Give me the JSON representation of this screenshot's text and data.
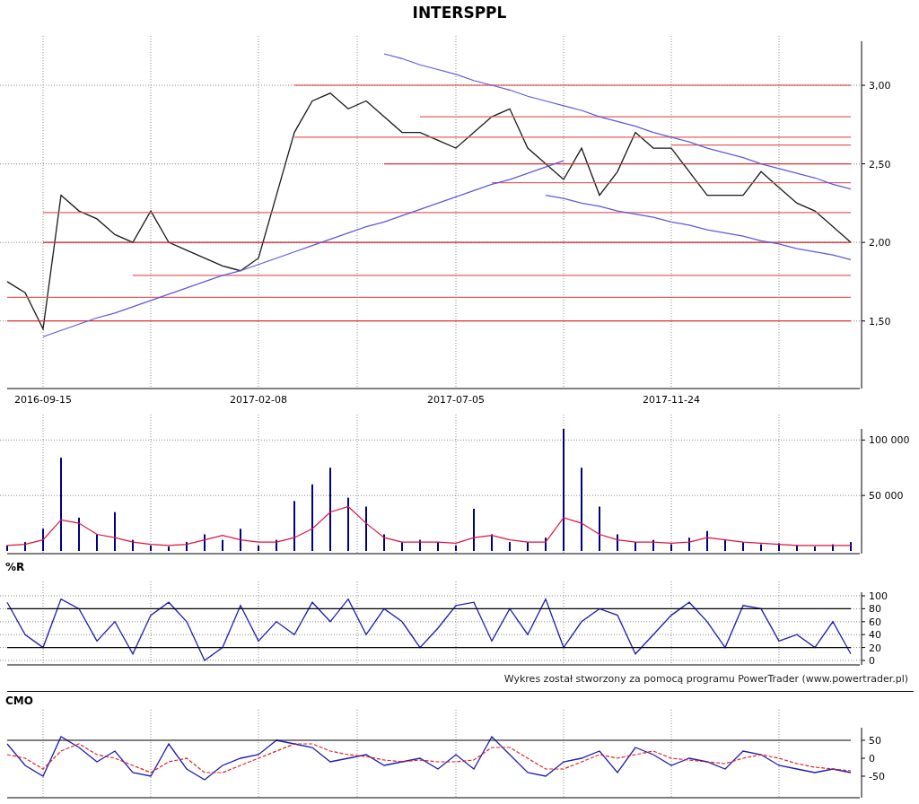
{
  "title": "INTERSPPL",
  "price_panel": {
    "chart_data": {
      "type": "line",
      "categories": [
        null,
        null,
        "2016-09-15",
        null,
        null,
        null,
        null,
        null,
        null,
        null,
        null,
        null,
        null,
        null,
        "2017-02-08",
        null,
        null,
        null,
        null,
        null,
        null,
        null,
        null,
        null,
        null,
        "2017-07-05",
        null,
        null,
        null,
        null,
        null,
        null,
        null,
        null,
        null,
        null,
        null,
        "2017-11-24",
        null,
        null,
        null,
        null,
        null,
        null,
        null,
        null,
        null,
        null
      ],
      "ylim": [
        1.07,
        3.28
      ],
      "grid": true,
      "yticks": [
        {
          "value": 1.5,
          "label": "1,50"
        },
        {
          "value": 2.0,
          "label": "2,00"
        },
        {
          "value": 2.5,
          "label": "2,50"
        },
        {
          "value": 3.0,
          "label": "3,00"
        }
      ],
      "series": [
        {
          "color": "#1a1a1a",
          "values": [
            1.75,
            1.68,
            1.45,
            2.3,
            2.2,
            2.15,
            2.05,
            2.0,
            2.2,
            2.0,
            1.95,
            1.9,
            1.85,
            1.82,
            1.9,
            2.3,
            2.7,
            2.9,
            2.95,
            2.85,
            2.9,
            2.8,
            2.7,
            2.7,
            2.65,
            2.6,
            2.7,
            2.8,
            2.85,
            2.6,
            2.5,
            2.4,
            2.6,
            2.3,
            2.45,
            2.7,
            2.6,
            2.6,
            2.45,
            2.3,
            2.3,
            2.3,
            2.45,
            2.35,
            2.25,
            2.2,
            2.1,
            2.0
          ]
        },
        {
          "color": "#e03030",
          "values": [
            null,
            null,
            null,
            null,
            null,
            null,
            null,
            null,
            null,
            null,
            null,
            null,
            null,
            null,
            null,
            null,
            3.0,
            3.0,
            3.0,
            3.0,
            3.0,
            3.0,
            3.0,
            3.0,
            3.0,
            3.0,
            3.0,
            3.0,
            3.0,
            3.0,
            3.0,
            3.0,
            3.0,
            3.0,
            3.0,
            3.0,
            3.0,
            3.0,
            3.0,
            3.0,
            3.0,
            3.0,
            3.0,
            3.0,
            3.0,
            3.0,
            3.0,
            3.0
          ]
        },
        {
          "color": "#e06060",
          "values": [
            null,
            null,
            null,
            null,
            null,
            null,
            null,
            null,
            null,
            null,
            null,
            null,
            null,
            null,
            null,
            null,
            null,
            null,
            null,
            null,
            null,
            null,
            null,
            2.8,
            2.8,
            2.8,
            2.8,
            2.8,
            2.8,
            2.8,
            2.8,
            2.8,
            2.8,
            2.8,
            2.8,
            2.8,
            2.8,
            2.8,
            2.8,
            2.8,
            2.8,
            2.8,
            2.8,
            2.8,
            2.8,
            2.8,
            2.8,
            2.8
          ]
        },
        {
          "color": "#e06060",
          "values": [
            null,
            null,
            null,
            null,
            null,
            null,
            null,
            null,
            null,
            null,
            null,
            null,
            null,
            null,
            null,
            null,
            2.67,
            2.67,
            2.67,
            2.67,
            2.67,
            2.67,
            2.67,
            2.67,
            2.67,
            2.67,
            2.67,
            2.67,
            2.67,
            2.67,
            2.67,
            2.67,
            2.67,
            2.67,
            2.67,
            2.67,
            2.67,
            2.67,
            2.67,
            2.67,
            2.67,
            2.67,
            2.67,
            2.67,
            2.67,
            2.67,
            2.67,
            2.67
          ]
        },
        {
          "color": "#e06060",
          "values": [
            null,
            null,
            null,
            null,
            null,
            null,
            null,
            null,
            null,
            null,
            null,
            null,
            null,
            null,
            null,
            null,
            null,
            null,
            null,
            null,
            null,
            null,
            null,
            null,
            null,
            null,
            null,
            null,
            null,
            null,
            null,
            null,
            null,
            null,
            null,
            null,
            null,
            2.62,
            2.62,
            2.62,
            2.62,
            2.62,
            2.62,
            2.62,
            2.62,
            2.62,
            2.62,
            2.62
          ]
        },
        {
          "color": "#e03030",
          "values": [
            null,
            null,
            null,
            null,
            null,
            null,
            null,
            null,
            null,
            null,
            null,
            null,
            null,
            null,
            null,
            null,
            null,
            null,
            null,
            null,
            null,
            2.5,
            2.5,
            2.5,
            2.5,
            2.5,
            2.5,
            2.5,
            2.5,
            2.5,
            2.5,
            2.5,
            2.5,
            2.5,
            2.5,
            2.5,
            2.5,
            2.5,
            2.5,
            2.5,
            2.5,
            2.5,
            2.5,
            2.5,
            2.5,
            2.5,
            2.5,
            2.5
          ]
        },
        {
          "color": "#e06060",
          "values": [
            null,
            null,
            null,
            null,
            null,
            null,
            null,
            null,
            null,
            null,
            null,
            null,
            null,
            null,
            null,
            null,
            null,
            null,
            null,
            null,
            null,
            null,
            null,
            null,
            null,
            null,
            null,
            2.38,
            2.38,
            2.38,
            2.38,
            2.38,
            2.38,
            2.38,
            2.38,
            2.38,
            2.38,
            2.38,
            2.38,
            2.38,
            2.38,
            2.38,
            2.38,
            2.38,
            2.38,
            2.38,
            2.38,
            2.38
          ]
        },
        {
          "color": "#e06060",
          "values": [
            null,
            null,
            2.19,
            2.19,
            2.19,
            2.19,
            2.19,
            2.19,
            2.19,
            2.19,
            2.19,
            2.19,
            2.19,
            2.19,
            2.19,
            2.19,
            2.19,
            2.19,
            2.19,
            2.19,
            2.19,
            2.19,
            2.19,
            2.19,
            2.19,
            2.19,
            2.19,
            2.19,
            2.19,
            2.19,
            2.19,
            2.19,
            2.19,
            2.19,
            2.19,
            2.19,
            2.19,
            2.19,
            2.19,
            2.19,
            2.19,
            2.19,
            2.19,
            2.19,
            2.19,
            2.19,
            2.19,
            2.19
          ]
        },
        {
          "color": "#d02020",
          "values": [
            null,
            null,
            2.0,
            2.0,
            2.0,
            2.0,
            2.0,
            2.0,
            2.0,
            2.0,
            2.0,
            2.0,
            2.0,
            2.0,
            2.0,
            2.0,
            2.0,
            2.0,
            2.0,
            2.0,
            2.0,
            2.0,
            2.0,
            2.0,
            2.0,
            2.0,
            2.0,
            2.0,
            2.0,
            2.0,
            2.0,
            2.0,
            2.0,
            2.0,
            2.0,
            2.0,
            2.0,
            2.0,
            2.0,
            2.0,
            2.0,
            2.0,
            2.0,
            2.0,
            2.0,
            2.0,
            2.0,
            2.0
          ]
        },
        {
          "color": "#e06060",
          "values": [
            null,
            null,
            null,
            null,
            null,
            null,
            null,
            1.79,
            1.79,
            1.79,
            1.79,
            1.79,
            1.79,
            1.79,
            1.79,
            1.79,
            1.79,
            1.79,
            1.79,
            1.79,
            1.79,
            1.79,
            1.79,
            1.79,
            1.79,
            1.79,
            1.79,
            1.79,
            1.79,
            1.79,
            1.79,
            1.79,
            1.79,
            1.79,
            1.79,
            1.79,
            1.79,
            1.79,
            1.79,
            1.79,
            1.79,
            1.79,
            1.79,
            1.79,
            1.79,
            1.79,
            1.79,
            1.79
          ]
        },
        {
          "color": "#e06060",
          "values": [
            1.65,
            1.65,
            1.65,
            1.65,
            1.65,
            1.65,
            1.65,
            1.65,
            1.65,
            1.65,
            1.65,
            1.65,
            1.65,
            1.65,
            1.65,
            1.65,
            1.65,
            1.65,
            1.65,
            1.65,
            1.65,
            1.65,
            1.65,
            1.65,
            1.65,
            1.65,
            1.65,
            1.65,
            1.65,
            1.65,
            1.65,
            1.65,
            1.65,
            1.65,
            1.65,
            1.65,
            1.65,
            1.65,
            1.65,
            1.65,
            1.65,
            1.65,
            1.65,
            1.65,
            1.65,
            1.65,
            1.65,
            1.65
          ]
        },
        {
          "color": "#e03030",
          "values": [
            1.5,
            1.5,
            1.5,
            1.5,
            1.5,
            1.5,
            1.5,
            1.5,
            1.5,
            1.5,
            1.5,
            1.5,
            1.5,
            1.5,
            1.5,
            1.5,
            1.5,
            1.5,
            1.5,
            1.5,
            1.5,
            1.5,
            1.5,
            1.5,
            1.5,
            1.5,
            1.5,
            1.5,
            1.5,
            1.5,
            1.5,
            1.5,
            1.5,
            1.5,
            1.5,
            1.5,
            1.5,
            1.5,
            1.5,
            1.5,
            1.5,
            1.5,
            1.5,
            1.5,
            1.5,
            1.5,
            1.5,
            1.5
          ]
        },
        {
          "color": "#5a5adc",
          "values": [
            null,
            null,
            1.4,
            1.44,
            1.48,
            1.52,
            1.55,
            1.59,
            1.63,
            1.67,
            1.71,
            1.75,
            1.79,
            1.82,
            1.86,
            1.9,
            1.94,
            1.98,
            2.02,
            2.06,
            2.1,
            2.13,
            2.17,
            2.21,
            2.25,
            2.29,
            2.33,
            2.37,
            2.4,
            2.44,
            2.48,
            2.52,
            null,
            null,
            null,
            null,
            null,
            null,
            null,
            null,
            null,
            null,
            null,
            null,
            null,
            null,
            null,
            null
          ]
        },
        {
          "color": "#5a5adc",
          "values": [
            null,
            null,
            null,
            null,
            null,
            null,
            null,
            null,
            null,
            null,
            null,
            null,
            null,
            null,
            null,
            null,
            null,
            null,
            null,
            null,
            null,
            3.2,
            3.17,
            3.13,
            3.1,
            3.07,
            3.03,
            3.0,
            2.97,
            2.93,
            2.9,
            2.87,
            2.84,
            2.8,
            2.77,
            2.74,
            2.7,
            2.67,
            2.64,
            2.6,
            2.57,
            2.54,
            2.5,
            2.47,
            2.44,
            2.41,
            2.37,
            2.34
          ]
        },
        {
          "color": "#5a5adc",
          "values": [
            null,
            null,
            null,
            null,
            null,
            null,
            null,
            null,
            null,
            null,
            null,
            null,
            null,
            null,
            null,
            null,
            null,
            null,
            null,
            null,
            null,
            null,
            null,
            null,
            null,
            null,
            null,
            null,
            null,
            null,
            2.3,
            2.28,
            2.25,
            2.23,
            2.2,
            2.18,
            2.16,
            2.13,
            2.11,
            2.08,
            2.06,
            2.04,
            2.01,
            1.99,
            1.96,
            1.94,
            1.92,
            1.89
          ]
        }
      ]
    }
  },
  "volume_panel": {
    "chart_data": {
      "type": "bar",
      "categories": [
        null,
        null,
        null,
        null,
        null,
        null,
        null,
        null,
        null,
        null,
        null,
        null,
        null,
        null,
        null,
        null,
        null,
        null,
        null,
        null,
        null,
        null,
        null,
        null,
        null,
        null,
        null,
        null,
        null,
        null,
        null,
        null,
        null,
        null,
        null,
        null,
        null,
        null,
        null,
        null,
        null,
        null,
        null,
        null,
        null,
        null,
        null,
        null
      ],
      "ylim": [
        0,
        110000
      ],
      "grid": true,
      "yticks": [
        {
          "value": 50000,
          "label": "50 000"
        },
        {
          "value": 100000,
          "label": "100 000"
        }
      ],
      "series": [
        {
          "color": "#000080",
          "values": [
            5000,
            8000,
            20000,
            84000,
            30000,
            15000,
            35000,
            10000,
            5000,
            4000,
            8000,
            15000,
            10000,
            20000,
            5000,
            10000,
            45000,
            60000,
            75000,
            48000,
            40000,
            15000,
            8000,
            10000,
            8000,
            5000,
            38000,
            15000,
            8000,
            8000,
            12000,
            110000,
            75000,
            40000,
            15000,
            8000,
            10000,
            6000,
            12000,
            18000,
            10000,
            8000,
            6000,
            7000,
            5000,
            4000,
            6000,
            8000
          ]
        },
        {
          "type": "line",
          "color": "#dc143c",
          "values": [
            5000,
            6000,
            10000,
            28000,
            25000,
            15000,
            12000,
            8000,
            6000,
            5000,
            6000,
            10000,
            14000,
            10000,
            8000,
            8000,
            12000,
            20000,
            35000,
            40000,
            25000,
            12000,
            8000,
            8000,
            8000,
            7000,
            12000,
            14000,
            10000,
            8000,
            8000,
            30000,
            25000,
            15000,
            10000,
            8000,
            8000,
            7000,
            8000,
            12000,
            10000,
            8000,
            7000,
            6000,
            5000,
            5000,
            5000,
            5000
          ]
        }
      ]
    }
  },
  "r_panel": {
    "label": "%R",
    "chart_data": {
      "type": "line",
      "categories": [
        null,
        null,
        null,
        null,
        null,
        null,
        null,
        null,
        null,
        null,
        null,
        null,
        null,
        null,
        null,
        null,
        null,
        null,
        null,
        null,
        null,
        null,
        null,
        null,
        null,
        null,
        null,
        null,
        null,
        null,
        null,
        null,
        null,
        null,
        null,
        null,
        null,
        null,
        null,
        null,
        null,
        null,
        null,
        null,
        null,
        null,
        null,
        null
      ],
      "ylim": [
        0,
        100
      ],
      "grid": true,
      "yticks": [
        0,
        20,
        40,
        60,
        80,
        100
      ],
      "series": [
        {
          "color": "#1c1cb4",
          "values": [
            90,
            40,
            20,
            95,
            80,
            30,
            60,
            10,
            70,
            90,
            60,
            0,
            20,
            85,
            30,
            60,
            40,
            90,
            60,
            95,
            40,
            80,
            60,
            20,
            50,
            85,
            90,
            30,
            80,
            40,
            95,
            20,
            60,
            80,
            70,
            10,
            40,
            70,
            90,
            60,
            20,
            85,
            80,
            30,
            40,
            20,
            60,
            10
          ]
        },
        {
          "color": "#000000",
          "values": [
            80,
            80,
            80,
            80,
            80,
            80,
            80,
            80,
            80,
            80,
            80,
            80,
            80,
            80,
            80,
            80,
            80,
            80,
            80,
            80,
            80,
            80,
            80,
            80,
            80,
            80,
            80,
            80,
            80,
            80,
            80,
            80,
            80,
            80,
            80,
            80,
            80,
            80,
            80,
            80,
            80,
            80,
            80,
            80,
            80,
            80,
            80,
            80
          ]
        },
        {
          "color": "#000000",
          "values": [
            20,
            20,
            20,
            20,
            20,
            20,
            20,
            20,
            20,
            20,
            20,
            20,
            20,
            20,
            20,
            20,
            20,
            20,
            20,
            20,
            20,
            20,
            20,
            20,
            20,
            20,
            20,
            20,
            20,
            20,
            20,
            20,
            20,
            20,
            20,
            20,
            20,
            20,
            20,
            20,
            20,
            20,
            20,
            20,
            20,
            20,
            20,
            20
          ]
        }
      ]
    }
  },
  "credit": "Wykres został stworzony za pomocą programu PowerTrader (www.powertrader.pl)",
  "cmo_panel": {
    "label": "CMO",
    "chart_data": {
      "type": "line",
      "categories": [
        null,
        null,
        null,
        null,
        null,
        null,
        null,
        null,
        null,
        null,
        null,
        null,
        null,
        null,
        null,
        null,
        null,
        null,
        null,
        null,
        null,
        null,
        null,
        null,
        null,
        null,
        null,
        null,
        null,
        null,
        null,
        null,
        null,
        null,
        null,
        null,
        null,
        null,
        null,
        null,
        null,
        null,
        null,
        null,
        null,
        null,
        null,
        null
      ],
      "ylim": [
        -110,
        85
      ],
      "grid": true,
      "yticks": [
        {
          "value": -50,
          "label": "-50"
        },
        {
          "value": 0,
          "label": "0"
        },
        {
          "value": 50,
          "label": "50"
        }
      ],
      "series": [
        {
          "color": "#1c1cb4",
          "values": [
            40,
            -20,
            -50,
            60,
            30,
            -10,
            20,
            -40,
            -50,
            40,
            -30,
            -60,
            -20,
            0,
            10,
            50,
            40,
            30,
            -10,
            0,
            10,
            -20,
            -10,
            0,
            -30,
            10,
            -30,
            60,
            10,
            -40,
            -50,
            -10,
            0,
            20,
            -40,
            30,
            10,
            -20,
            0,
            -10,
            -30,
            20,
            10,
            -20,
            -30,
            -40,
            -30,
            -40
          ]
        },
        {
          "color": "#e02020",
          "line_style": "dashed",
          "values": [
            10,
            0,
            -30,
            20,
            40,
            10,
            0,
            -20,
            -40,
            -10,
            0,
            -40,
            -40,
            -20,
            0,
            20,
            40,
            40,
            20,
            10,
            5,
            -5,
            -10,
            -5,
            -10,
            -10,
            -5,
            30,
            30,
            0,
            -30,
            -30,
            -10,
            10,
            0,
            10,
            20,
            0,
            -5,
            -10,
            -15,
            0,
            10,
            0,
            -15,
            -25,
            -30,
            -35
          ]
        },
        {
          "color": "#000000",
          "values": [
            50,
            50,
            50,
            50,
            50,
            50,
            50,
            50,
            50,
            50,
            50,
            50,
            50,
            50,
            50,
            50,
            50,
            50,
            50,
            50,
            50,
            50,
            50,
            50,
            50,
            50,
            50,
            50,
            50,
            50,
            50,
            50,
            50,
            50,
            50,
            50,
            50,
            50,
            50,
            50,
            50,
            50,
            50,
            50,
            50,
            50,
            50,
            50
          ]
        }
      ]
    }
  }
}
